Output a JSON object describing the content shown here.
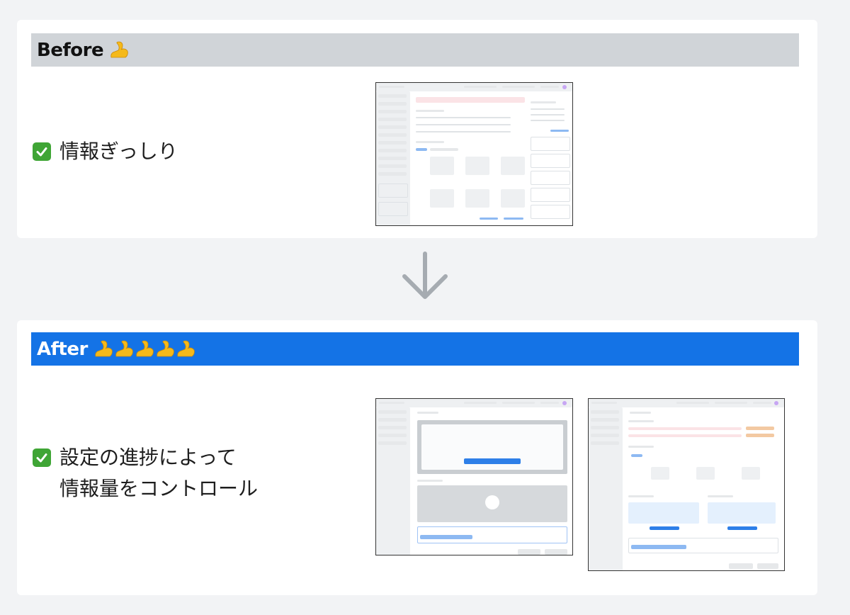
{
  "before": {
    "title": "Before",
    "arm_count": 1,
    "check_text": "情報ぎっしり"
  },
  "after": {
    "title": "After",
    "arm_count": 5,
    "check_text_line1": "設定の進捗によって",
    "check_text_line2": "情報量をコントロール"
  },
  "icons": {
    "arm": "flexed-biceps-icon",
    "check": "check-mark-icon",
    "arrow": "down-arrow-icon"
  },
  "colors": {
    "before_header": "#d0d4d8",
    "after_header": "#1473e6",
    "check_green": "#3fa535",
    "arm_yellow": "#f5b91a",
    "arrow_gray": "#a6abb1"
  }
}
